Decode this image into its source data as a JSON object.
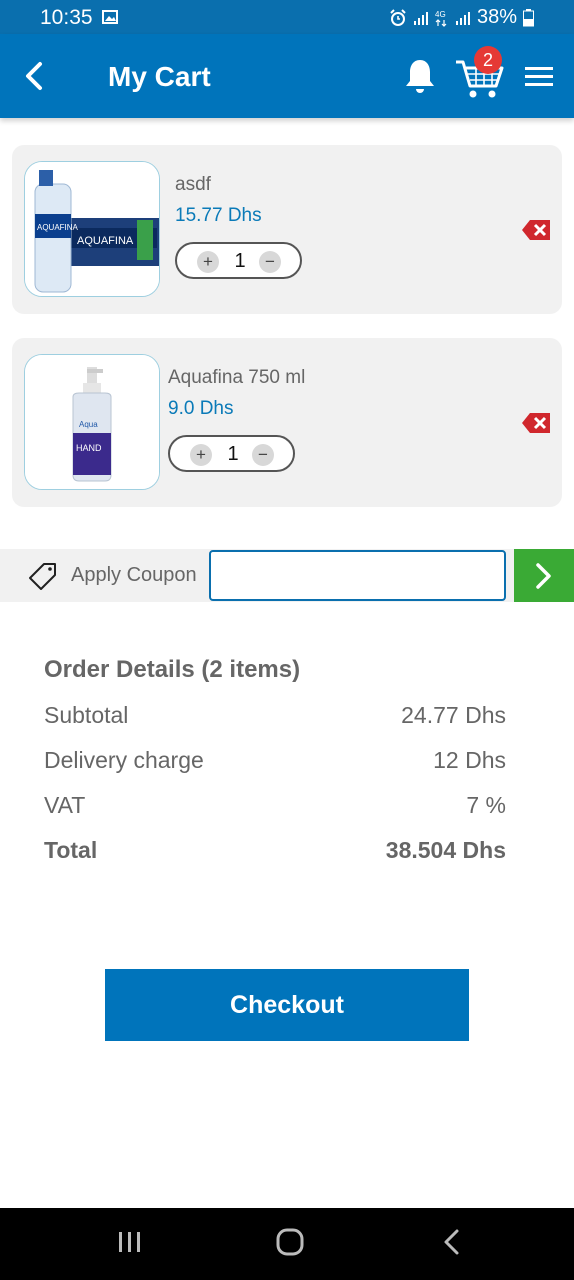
{
  "status": {
    "time": "10:35",
    "battery": "38%",
    "icons": [
      "image-icon",
      "alarm-icon",
      "signal-icon",
      "4g-icon",
      "signal-icon-2",
      "battery-icon"
    ]
  },
  "appbar": {
    "title": "My Cart",
    "cart_count": "2",
    "icons": [
      "back-arrow-icon",
      "bell-icon",
      "cart-icon",
      "menu-icon"
    ]
  },
  "accent_color": "#0074bb",
  "cart": {
    "items": [
      {
        "name": "asdf",
        "price": "15.77 Dhs",
        "quantity": "1",
        "image": "water-bottles-pack"
      },
      {
        "name": "Aquafina 750 ml",
        "price": "9.0 Dhs",
        "quantity": "1",
        "image": "hand-sanitizer-bottle"
      }
    ],
    "plus": "+",
    "minus": "−"
  },
  "coupon": {
    "label": "Apply Coupon",
    "value": "",
    "placeholder": ""
  },
  "order_details": {
    "title": "Order Details (2 items)",
    "rows": [
      {
        "label": "Subtotal",
        "value": "24.77 Dhs"
      },
      {
        "label": "Delivery charge",
        "value": "12 Dhs"
      },
      {
        "label": "VAT",
        "value": "7 %"
      },
      {
        "label": "Total",
        "value": "38.504 Dhs"
      }
    ]
  },
  "checkout_label": "Checkout"
}
